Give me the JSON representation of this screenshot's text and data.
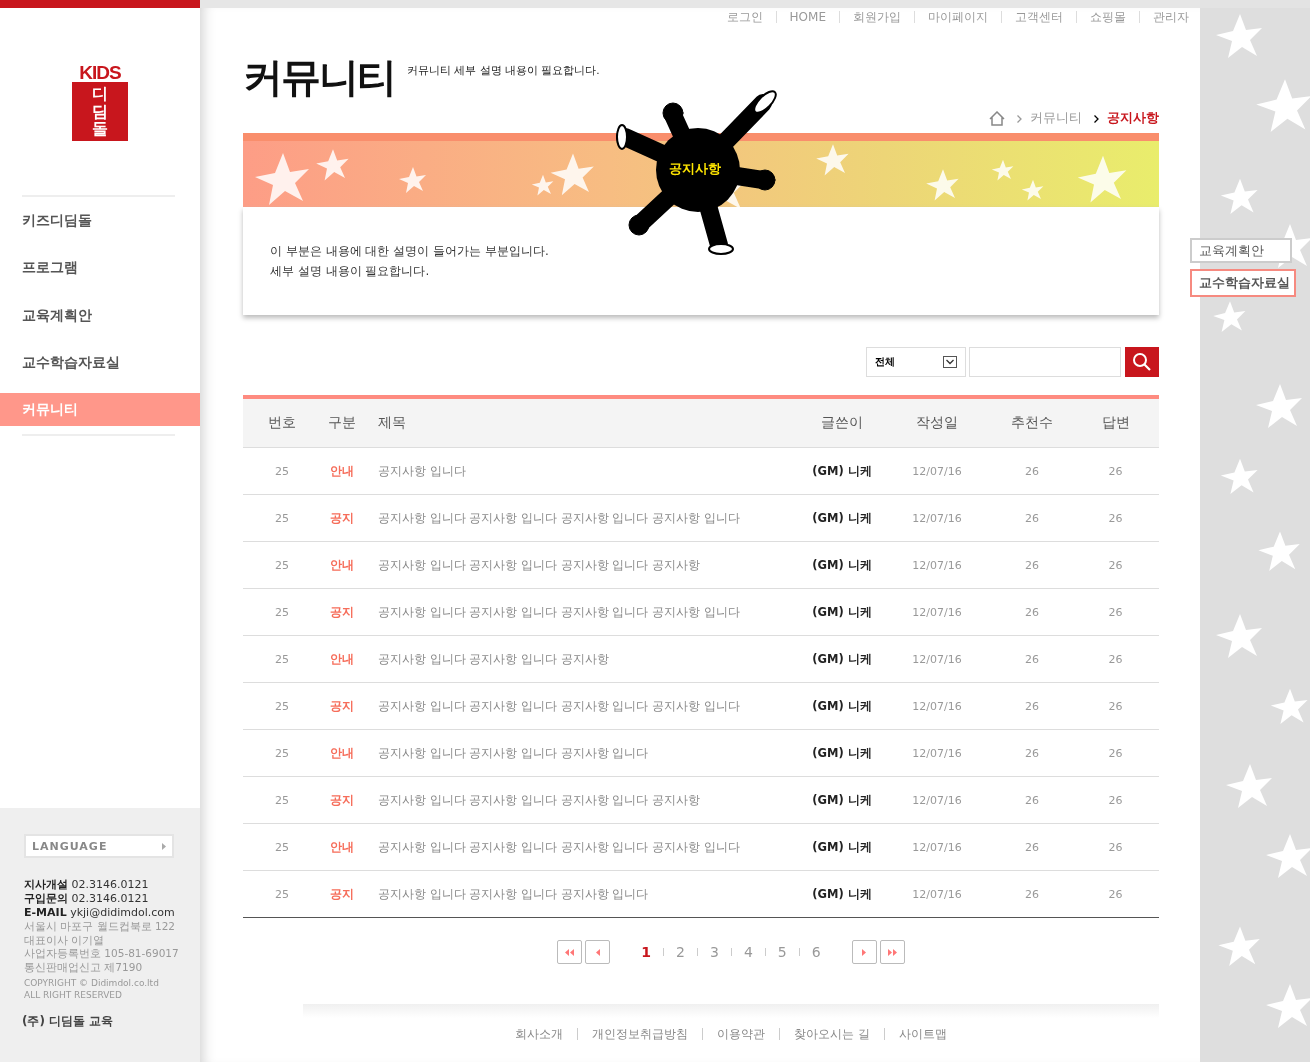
{
  "logo": {
    "top": "KIDS",
    "name": "디딤돌"
  },
  "sidebar": {
    "items": [
      {
        "label": "키즈디딤돌",
        "selected": false
      },
      {
        "label": "프로그램",
        "selected": false
      },
      {
        "label": "교육계획안",
        "selected": false
      },
      {
        "label": "교수학습자료실",
        "selected": false
      },
      {
        "label": "커뮤니티",
        "selected": true
      }
    ],
    "language": "LANGUAGE",
    "contacts": [
      {
        "label": "지사개설",
        "value": "02.3146.0121"
      },
      {
        "label": "구입문의",
        "value": "02.3146.0121"
      },
      {
        "label": "E-MAIL",
        "value": "ykji@didimdol.com"
      }
    ],
    "info": [
      "서울시 마포구 월드컵북로 122",
      "대표이사 이기열",
      "사업자등록번호 105-81-69017",
      "통신판매업신고 제7190"
    ],
    "copyright": [
      "COPYRIGHT © Didimdol.co.ltd",
      "ALL RIGHT RESERVED"
    ],
    "company": "(주) 디딤돌 교육"
  },
  "top_nav": [
    "로그인",
    "HOME",
    "회원가입",
    "마이페이지",
    "고객센터",
    "쇼핑몰",
    "관리자"
  ],
  "page": {
    "title": "커뮤니티",
    "subtitle": "커뮤니티 세부 설명 내용이 필요합니다.",
    "breadcrumb": [
      "커뮤니티",
      "공지사항"
    ],
    "badge": "공지사항",
    "description": [
      "이 부분은 내용에 대한 설명이 들어가는 부분입니다.",
      "세부 설명 내용이 필요합니다."
    ]
  },
  "search": {
    "filter": "전체"
  },
  "table": {
    "columns": [
      "번호",
      "구분",
      "제목",
      "글쓴이",
      "작성일",
      "추천수",
      "답변"
    ],
    "rows": [
      {
        "no": "25",
        "category": "안내",
        "title": "공지사항 입니다",
        "author": "(GM) 니케",
        "date": "12/07/16",
        "likes": "26",
        "replies": "26"
      },
      {
        "no": "25",
        "category": "공지",
        "title": "공지사항 입니다 공지사항 입니다 공지사항 입니다 공지사항 입니다",
        "author": "(GM) 니케",
        "date": "12/07/16",
        "likes": "26",
        "replies": "26"
      },
      {
        "no": "25",
        "category": "안내",
        "title": "공지사항 입니다 공지사항 입니다 공지사항 입니다 공지사항",
        "author": "(GM) 니케",
        "date": "12/07/16",
        "likes": "26",
        "replies": "26"
      },
      {
        "no": "25",
        "category": "공지",
        "title": "공지사항 입니다 공지사항 입니다 공지사항 입니다 공지사항 입니다",
        "author": "(GM) 니케",
        "date": "12/07/16",
        "likes": "26",
        "replies": "26"
      },
      {
        "no": "25",
        "category": "안내",
        "title": "공지사항 입니다 공지사항 입니다 공지사항",
        "author": "(GM) 니케",
        "date": "12/07/16",
        "likes": "26",
        "replies": "26"
      },
      {
        "no": "25",
        "category": "공지",
        "title": "공지사항 입니다 공지사항 입니다 공지사항 입니다 공지사항 입니다",
        "author": "(GM) 니케",
        "date": "12/07/16",
        "likes": "26",
        "replies": "26"
      },
      {
        "no": "25",
        "category": "안내",
        "title": "공지사항 입니다 공지사항 입니다 공지사항 입니다",
        "author": "(GM) 니케",
        "date": "12/07/16",
        "likes": "26",
        "replies": "26"
      },
      {
        "no": "25",
        "category": "공지",
        "title": "공지사항 입니다 공지사항 입니다 공지사항 입니다 공지사항",
        "author": "(GM) 니케",
        "date": "12/07/16",
        "likes": "26",
        "replies": "26"
      },
      {
        "no": "25",
        "category": "안내",
        "title": "공지사항 입니다 공지사항 입니다 공지사항 입니다 공지사항 입니다",
        "author": "(GM) 니케",
        "date": "12/07/16",
        "likes": "26",
        "replies": "26"
      },
      {
        "no": "25",
        "category": "공지",
        "title": "공지사항 입니다 공지사항 입니다 공지사항 입니다",
        "author": "(GM) 니케",
        "date": "12/07/16",
        "likes": "26",
        "replies": "26"
      }
    ]
  },
  "pagination": [
    {
      "label": "1",
      "selected": true
    },
    {
      "label": "2",
      "selected": false
    },
    {
      "label": "3",
      "selected": false
    },
    {
      "label": "4",
      "selected": false
    },
    {
      "label": "5",
      "selected": false
    },
    {
      "label": "6",
      "selected": false
    }
  ],
  "footer_links": [
    "회사소개",
    "개인정보취급방침",
    "이용약관",
    "찾아오시는 길",
    "사이트맵"
  ],
  "quick_menu": [
    {
      "label": "교육계획안",
      "selected": false
    },
    {
      "label": "교수학습자료실",
      "selected": true
    }
  ]
}
